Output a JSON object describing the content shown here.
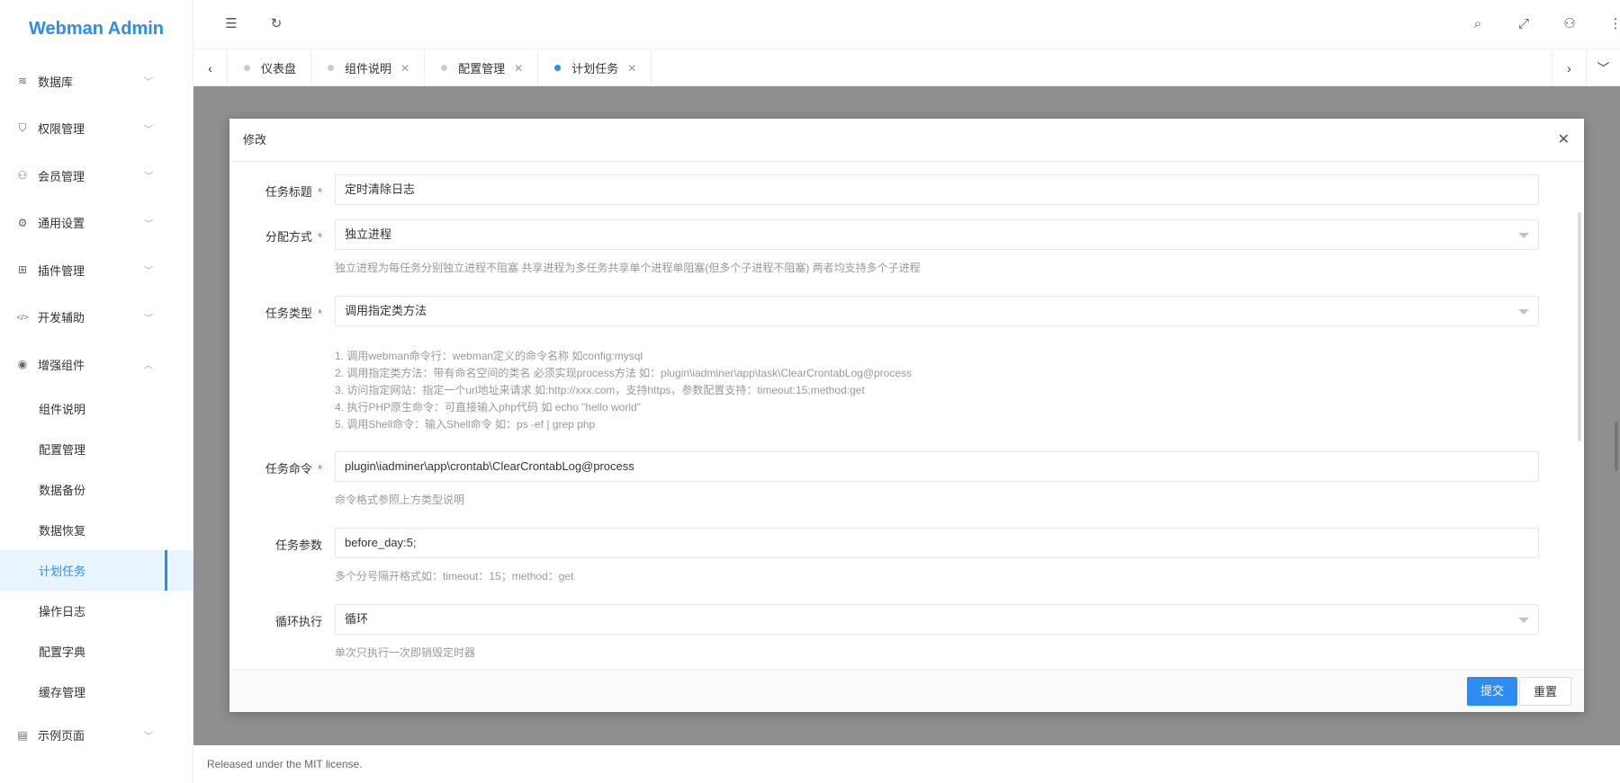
{
  "app": {
    "title": "Webman Admin"
  },
  "sidebar": {
    "items": [
      {
        "label": "数据库",
        "icon": "layers-icon",
        "glyph": "≋"
      },
      {
        "label": "权限管理",
        "icon": "shield-icon",
        "glyph": "⛉"
      },
      {
        "label": "会员管理",
        "icon": "user-icon",
        "glyph": "⚇"
      },
      {
        "label": "通用设置",
        "icon": "gear-icon",
        "glyph": "⚙"
      },
      {
        "label": "插件管理",
        "icon": "plugin-icon",
        "glyph": "⊞"
      },
      {
        "label": "开发辅助",
        "icon": "code-icon",
        "glyph": "</>"
      },
      {
        "label": "增强组件",
        "icon": "compass-icon",
        "glyph": "◉"
      }
    ],
    "sub_items": [
      "组件说明",
      "配置管理",
      "数据备份",
      "数据恢复",
      "计划任务",
      "操作日志",
      "配置字典",
      "缓存管理"
    ],
    "last_item": {
      "label": "示例页面",
      "icon": "page-icon",
      "glyph": "▤"
    }
  },
  "tabs": [
    {
      "label": "仪表盘"
    },
    {
      "label": "组件说明"
    },
    {
      "label": "配置管理"
    },
    {
      "label": "计划任务"
    }
  ],
  "modal": {
    "title": "修改",
    "fields": {
      "title": {
        "label": "任务标题",
        "value": "定时清除日志"
      },
      "mode": {
        "label": "分配方式",
        "value": "独立进程",
        "tip": "独立进程为每任务分别独立进程不阻塞 共享进程为多任务共享单个进程单阻塞(但多个子进程不阻塞) 两者均支持多个子进程"
      },
      "type": {
        "label": "任务类型",
        "value": "调用指定类方法"
      },
      "help": [
        "1. 调用webman命令行：webman定义的命令名称 如config:mysql",
        "2. 调用指定类方法：带有命名空间的类名 必须实现process方法 如：plugin\\iadminer\\app\\task\\ClearCrontabLog@process",
        "3. 访问指定网站：指定一个url地址来请求 如:http://xxx.com，支持https，参数配置支持：timeout:15;method:get",
        "4. 执行PHP原生命令：可直接输入php代码 如 echo \"hello world\"",
        "5. 调用Shell命令：输入Shell命令 如：ps -ef | grep php"
      ],
      "command": {
        "label": "任务命令",
        "value": "plugin\\iadminer\\app\\crontab\\ClearCrontabLog@process",
        "tip": "命令格式参照上方类型说明"
      },
      "params": {
        "label": "任务参数",
        "value": "before_day:5;",
        "tip": "多个分号隔开格式如：timeout：15；method：get"
      },
      "loop": {
        "label": "循环执行",
        "value": "循环",
        "tip": "单次只执行一次即销毁定时器"
      }
    },
    "submit_label": "提交",
    "reset_label": "重置"
  },
  "footer": {
    "text": "Released under the MIT license."
  }
}
